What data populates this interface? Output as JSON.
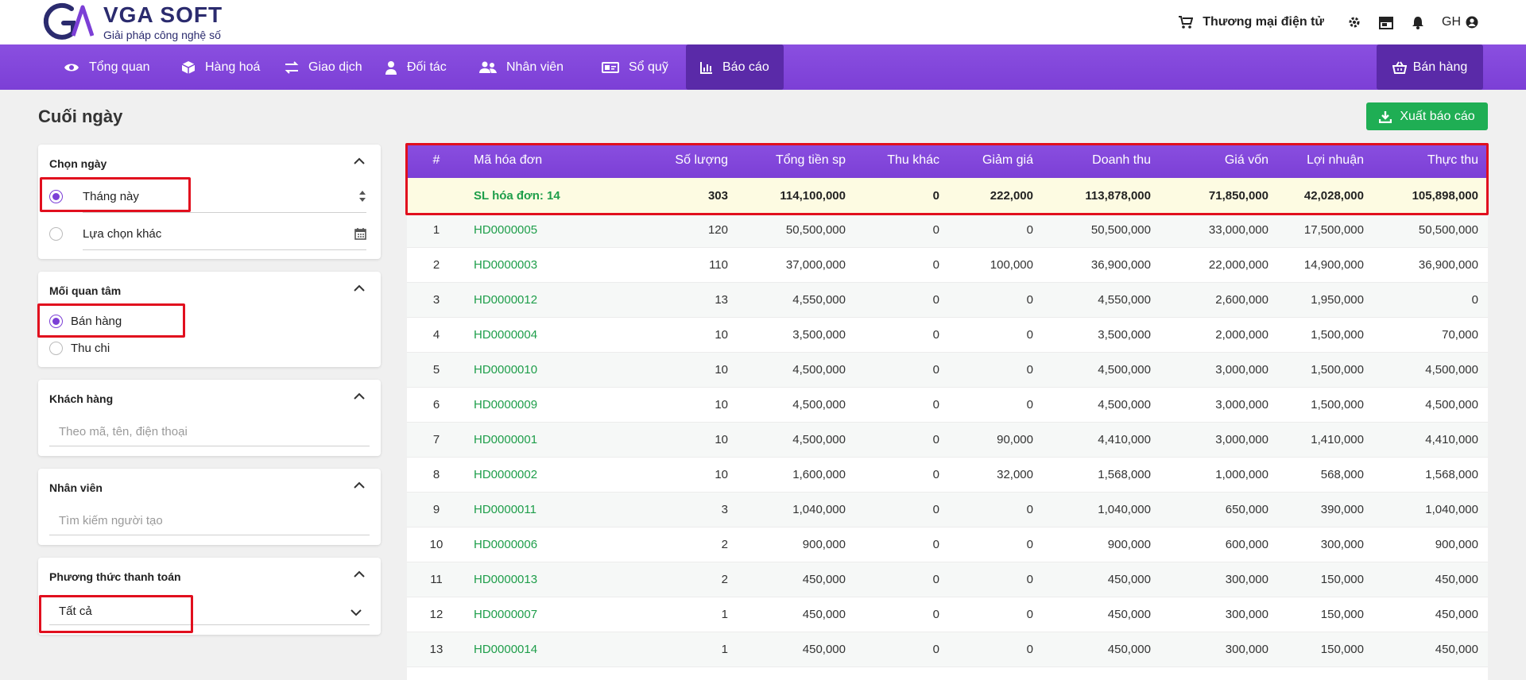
{
  "brand": {
    "name": "VGA SOFT",
    "tagline": "Giải pháp công nghệ số"
  },
  "header": {
    "ecommerce_label": "Thương mại điện tử",
    "user_initials": "GH"
  },
  "nav": {
    "items": [
      {
        "label": "Tổng quan",
        "icon": "eye-icon"
      },
      {
        "label": "Hàng hoá",
        "icon": "box-icon"
      },
      {
        "label": "Giao dịch",
        "icon": "exchange-icon"
      },
      {
        "label": "Đối tác",
        "icon": "person-icon"
      },
      {
        "label": "Nhân viên",
        "icon": "users-icon"
      },
      {
        "label": "Sổ quỹ",
        "icon": "money-icon"
      },
      {
        "label": "Báo cáo",
        "icon": "chart-icon"
      }
    ],
    "active_index": 6,
    "sell_label": "Bán hàng"
  },
  "page": {
    "title": "Cuối ngày",
    "export_label": "Xuất báo cáo"
  },
  "filters": {
    "date": {
      "title": "Chọn ngày",
      "option1": "Tháng này",
      "option2": "Lựa chọn khác"
    },
    "interest": {
      "title": "Mối quan tâm",
      "option1": "Bán hàng",
      "option2": "Thu chi"
    },
    "customer": {
      "title": "Khách hàng",
      "placeholder": "Theo mã, tên, điện thoại"
    },
    "staff": {
      "title": "Nhân viên",
      "placeholder": "Tìm kiếm người tạo"
    },
    "payment": {
      "title": "Phương thức thanh toán",
      "value": "Tất cả"
    }
  },
  "table": {
    "headers": [
      "#",
      "Mã hóa đơn",
      "Số lượng",
      "Tổng tiền sp",
      "Thu khác",
      "Giảm giá",
      "Doanh thu",
      "Giá vốn",
      "Lợi nhuận",
      "Thực thu"
    ],
    "summary": [
      "",
      "SL hóa đơn: 14",
      "303",
      "114,100,000",
      "0",
      "222,000",
      "113,878,000",
      "71,850,000",
      "42,028,000",
      "105,898,000"
    ],
    "rows": [
      [
        "1",
        "HD0000005",
        "120",
        "50,500,000",
        "0",
        "0",
        "50,500,000",
        "33,000,000",
        "17,500,000",
        "50,500,000"
      ],
      [
        "2",
        "HD0000003",
        "110",
        "37,000,000",
        "0",
        "100,000",
        "36,900,000",
        "22,000,000",
        "14,900,000",
        "36,900,000"
      ],
      [
        "3",
        "HD0000012",
        "13",
        "4,550,000",
        "0",
        "0",
        "4,550,000",
        "2,600,000",
        "1,950,000",
        "0"
      ],
      [
        "4",
        "HD0000004",
        "10",
        "3,500,000",
        "0",
        "0",
        "3,500,000",
        "2,000,000",
        "1,500,000",
        "70,000"
      ],
      [
        "5",
        "HD0000010",
        "10",
        "4,500,000",
        "0",
        "0",
        "4,500,000",
        "3,000,000",
        "1,500,000",
        "4,500,000"
      ],
      [
        "6",
        "HD0000009",
        "10",
        "4,500,000",
        "0",
        "0",
        "4,500,000",
        "3,000,000",
        "1,500,000",
        "4,500,000"
      ],
      [
        "7",
        "HD0000001",
        "10",
        "4,500,000",
        "0",
        "90,000",
        "4,410,000",
        "3,000,000",
        "1,410,000",
        "4,410,000"
      ],
      [
        "8",
        "HD0000002",
        "10",
        "1,600,000",
        "0",
        "32,000",
        "1,568,000",
        "1,000,000",
        "568,000",
        "1,568,000"
      ],
      [
        "9",
        "HD0000011",
        "3",
        "1,040,000",
        "0",
        "0",
        "1,040,000",
        "650,000",
        "390,000",
        "1,040,000"
      ],
      [
        "10",
        "HD0000006",
        "2",
        "900,000",
        "0",
        "0",
        "900,000",
        "600,000",
        "300,000",
        "900,000"
      ],
      [
        "11",
        "HD0000013",
        "2",
        "450,000",
        "0",
        "0",
        "450,000",
        "300,000",
        "150,000",
        "450,000"
      ],
      [
        "12",
        "HD0000007",
        "1",
        "450,000",
        "0",
        "0",
        "450,000",
        "300,000",
        "150,000",
        "450,000"
      ],
      [
        "13",
        "HD0000014",
        "1",
        "450,000",
        "0",
        "0",
        "450,000",
        "300,000",
        "150,000",
        "450,000"
      ]
    ]
  },
  "colors": {
    "primary": "#7c3fd6",
    "primary_dark": "#5a2aa8",
    "success": "#1fae54",
    "highlight": "#e10f1e"
  }
}
